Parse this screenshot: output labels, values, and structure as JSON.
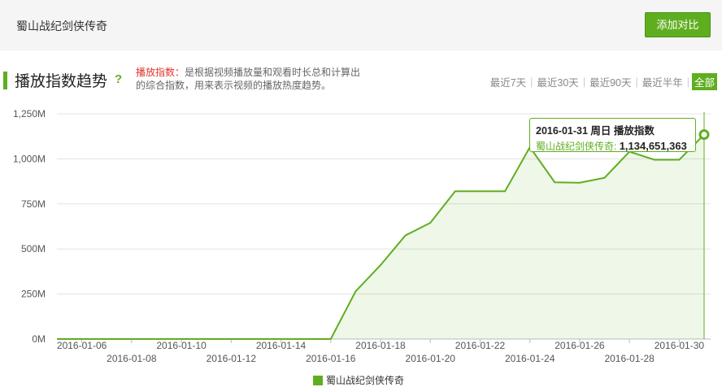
{
  "header": {
    "show_name": "蜀山战纪剑侠传奇",
    "add_compare": "添加对比"
  },
  "section": {
    "title": "播放指数趋势",
    "help": "?",
    "desc_keyword": "播放指数：",
    "desc_text": "是根据视频播放量和观看时长总和计算出的综合指数，用来表示视频的播放热度趋势。"
  },
  "ranges": [
    "最近7天",
    "最近30天",
    "最近90天",
    "最近半年",
    "全部"
  ],
  "active_range": "全部",
  "colors": {
    "accent": "#5fae20",
    "keyword": "#e0342a"
  },
  "tooltip": {
    "head": "2016-01-31 周日 播放指数",
    "series_label": "蜀山战纪剑侠传奇:",
    "value": "1,134,651,363"
  },
  "chart_data": {
    "type": "area",
    "title": "",
    "xlabel": "",
    "ylabel": "",
    "ylim": [
      0,
      1250000000
    ],
    "yticks": [
      "0M",
      "250M",
      "500M",
      "750M",
      "1,000M",
      "1,250M"
    ],
    "x": [
      "2016-01-05",
      "2016-01-06",
      "2016-01-07",
      "2016-01-08",
      "2016-01-09",
      "2016-01-10",
      "2016-01-11",
      "2016-01-12",
      "2016-01-13",
      "2016-01-14",
      "2016-01-15",
      "2016-01-16",
      "2016-01-17",
      "2016-01-18",
      "2016-01-19",
      "2016-01-20",
      "2016-01-21",
      "2016-01-22",
      "2016-01-23",
      "2016-01-24",
      "2016-01-25",
      "2016-01-26",
      "2016-01-27",
      "2016-01-28",
      "2016-01-29",
      "2016-01-30",
      "2016-01-31"
    ],
    "xtick_labels_upper": [
      "2016-01-06",
      "2016-01-10",
      "2016-01-14",
      "2016-01-18",
      "2016-01-22",
      "2016-01-26",
      "2016-01-30"
    ],
    "xtick_labels_lower": [
      "2016-01-08",
      "2016-01-12",
      "2016-01-16",
      "2016-01-20",
      "2016-01-24",
      "2016-01-28"
    ],
    "series": [
      {
        "name": "蜀山战纪剑侠传奇",
        "values": [
          0,
          0,
          0,
          0,
          0,
          0,
          0,
          0,
          0,
          0,
          0,
          0,
          265000000,
          410000000,
          575000000,
          645000000,
          820000000,
          820000000,
          820000000,
          1065000000,
          870000000,
          868000000,
          895000000,
          1040000000,
          995000000,
          995000000,
          1134651363
        ]
      }
    ],
    "legend": "bottom-center",
    "grid": true,
    "highlight_index": 26
  }
}
